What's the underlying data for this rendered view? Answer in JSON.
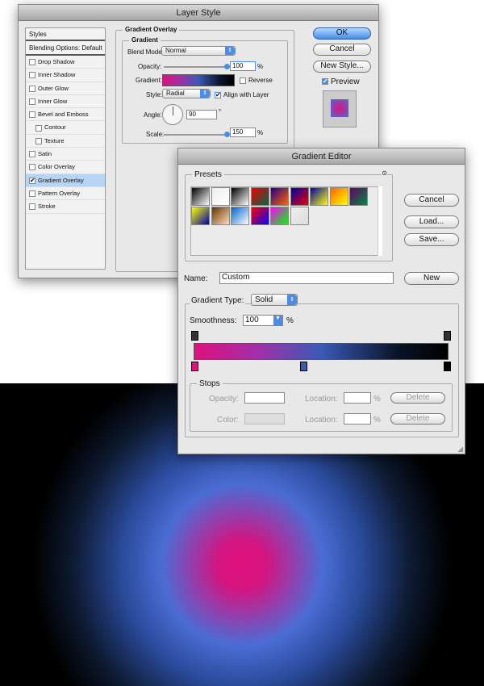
{
  "layer_style": {
    "title": "Layer Style",
    "styles_header": "Styles",
    "blending": "Blending Options: Default",
    "items": [
      {
        "label": "Drop Shadow",
        "checked": false
      },
      {
        "label": "Inner Shadow",
        "checked": false
      },
      {
        "label": "Outer Glow",
        "checked": false
      },
      {
        "label": "Inner Glow",
        "checked": false
      },
      {
        "label": "Bevel and Emboss",
        "checked": false
      },
      {
        "label": "Contour",
        "checked": false
      },
      {
        "label": "Texture",
        "checked": false
      },
      {
        "label": "Satin",
        "checked": false
      },
      {
        "label": "Color Overlay",
        "checked": false
      },
      {
        "label": "Gradient Overlay",
        "checked": true
      },
      {
        "label": "Pattern Overlay",
        "checked": false
      },
      {
        "label": "Stroke",
        "checked": false
      }
    ],
    "section": "Gradient Overlay",
    "subsection": "Gradient",
    "blend_mode_label": "Blend Mode:",
    "blend_mode": "Normal",
    "opacity_label": "Opacity:",
    "opacity": "100",
    "pct": "%",
    "gradient_label": "Gradient:",
    "reverse": "Reverse",
    "style_label": "Style:",
    "style": "Radial",
    "align": "Align with Layer",
    "angle_label": "Angle:",
    "angle": "90",
    "deg": "°",
    "scale_label": "Scale:",
    "scale": "150",
    "ok": "OK",
    "cancel": "Cancel",
    "new_style": "New Style...",
    "preview": "Preview"
  },
  "gradient_editor": {
    "title": "Gradient Editor",
    "presets": "Presets",
    "cancel": "Cancel",
    "load": "Load...",
    "save": "Save...",
    "name_label": "Name:",
    "name": "Custom",
    "new": "New",
    "type_label": "Gradient Type:",
    "type": "Solid",
    "smooth_label": "Smoothness:",
    "smoothness": "100",
    "pct": "%",
    "stops": "Stops",
    "opacity_label": "Opacity:",
    "location_label": "Location:",
    "color_label": "Color:",
    "delete": "Delete",
    "preset_colors": [
      [
        "#000",
        "#fff"
      ],
      [
        "#eee",
        "#fff"
      ],
      [
        "#000",
        "#fff"
      ],
      [
        "#e00",
        "#064"
      ],
      [
        "#208",
        "#f60"
      ],
      [
        "#00a",
        "#e00"
      ],
      [
        "#00a",
        "#ff0"
      ],
      [
        "#f60",
        "#ff0"
      ],
      [
        "#606",
        "#084"
      ],
      [
        "#ff0",
        "#00a"
      ],
      [
        "#630",
        "#fdb"
      ],
      [
        "#06c",
        "#fff"
      ],
      [
        "#f00",
        "#00f"
      ],
      [
        "#f0f",
        "#0f0"
      ],
      [
        "#eee",
        "#ddd"
      ]
    ],
    "stop_colors": [
      "#e0107e",
      "#3a5ab8",
      "#000000"
    ]
  }
}
